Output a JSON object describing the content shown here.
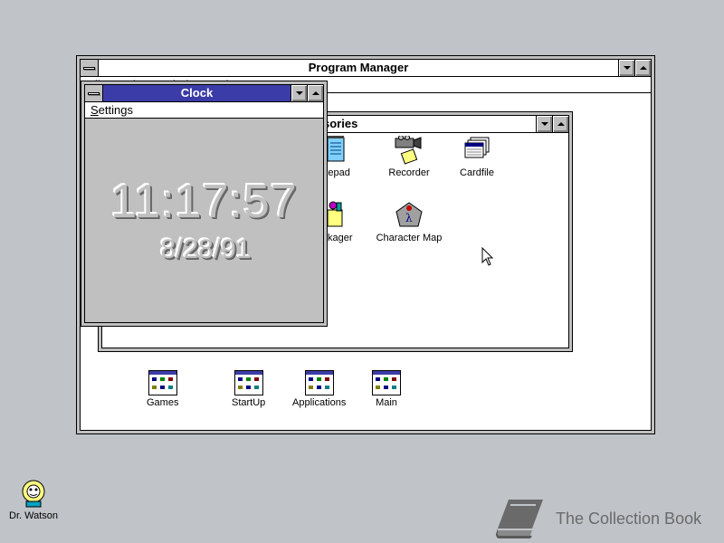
{
  "program_manager": {
    "title": "Program Manager",
    "menu": [
      "File",
      "Options",
      "Window",
      "Help"
    ],
    "groups": [
      {
        "label": "Games"
      },
      {
        "label": "StartUp"
      },
      {
        "label": "Applications"
      },
      {
        "label": "Main"
      }
    ]
  },
  "accessories": {
    "title_visible": "sories",
    "items": [
      {
        "label": "Notepad",
        "visible_label": "otepad",
        "icon": "notepad-icon"
      },
      {
        "label": "Recorder",
        "icon": "recorder-icon"
      },
      {
        "label": "Cardfile",
        "icon": "cardfile-icon"
      },
      {
        "label": "Packager",
        "visible_label": "ackager",
        "icon": "packager-icon"
      },
      {
        "label": "Character Map",
        "icon": "character-map-icon"
      }
    ]
  },
  "clock": {
    "title": "Clock",
    "menu_settings": "Settings",
    "menu_settings_rest": "ettings",
    "menu_settings_first": "S",
    "time": "11:17:57",
    "date": "8/28/91"
  },
  "desktop": {
    "dr_watson": "Dr. Watson"
  },
  "watermark": {
    "text": "The Collection Book"
  },
  "colors": {
    "desktop": "#c0c4c8",
    "active_title": "#3c3ca8",
    "window_bg": "#ffffff",
    "face": "#c0c0c0"
  }
}
